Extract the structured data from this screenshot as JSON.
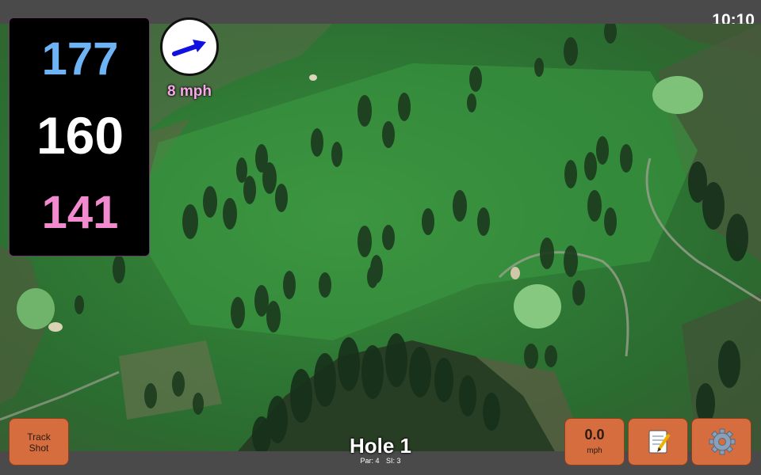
{
  "status": {
    "time": "10:10"
  },
  "distances": {
    "back": "177",
    "center": "160",
    "front": "141"
  },
  "wind": {
    "speed": "8 mph",
    "direction": "east-north-east",
    "arrow_color": "#1010e0"
  },
  "colors": {
    "back": "#6eb4f5",
    "center": "#ffffff",
    "front": "#f28ad0",
    "button": "#d56d3e"
  },
  "buttons": {
    "track_shot_line1": "Track",
    "track_shot_line2": "Shot",
    "speed_value": "0.0",
    "speed_unit": "mph",
    "notes_icon": "memo-icon",
    "settings_icon": "gear-icon"
  },
  "hole": {
    "title": "Hole 1",
    "par": "Par: 4",
    "si": "SI: 3"
  }
}
